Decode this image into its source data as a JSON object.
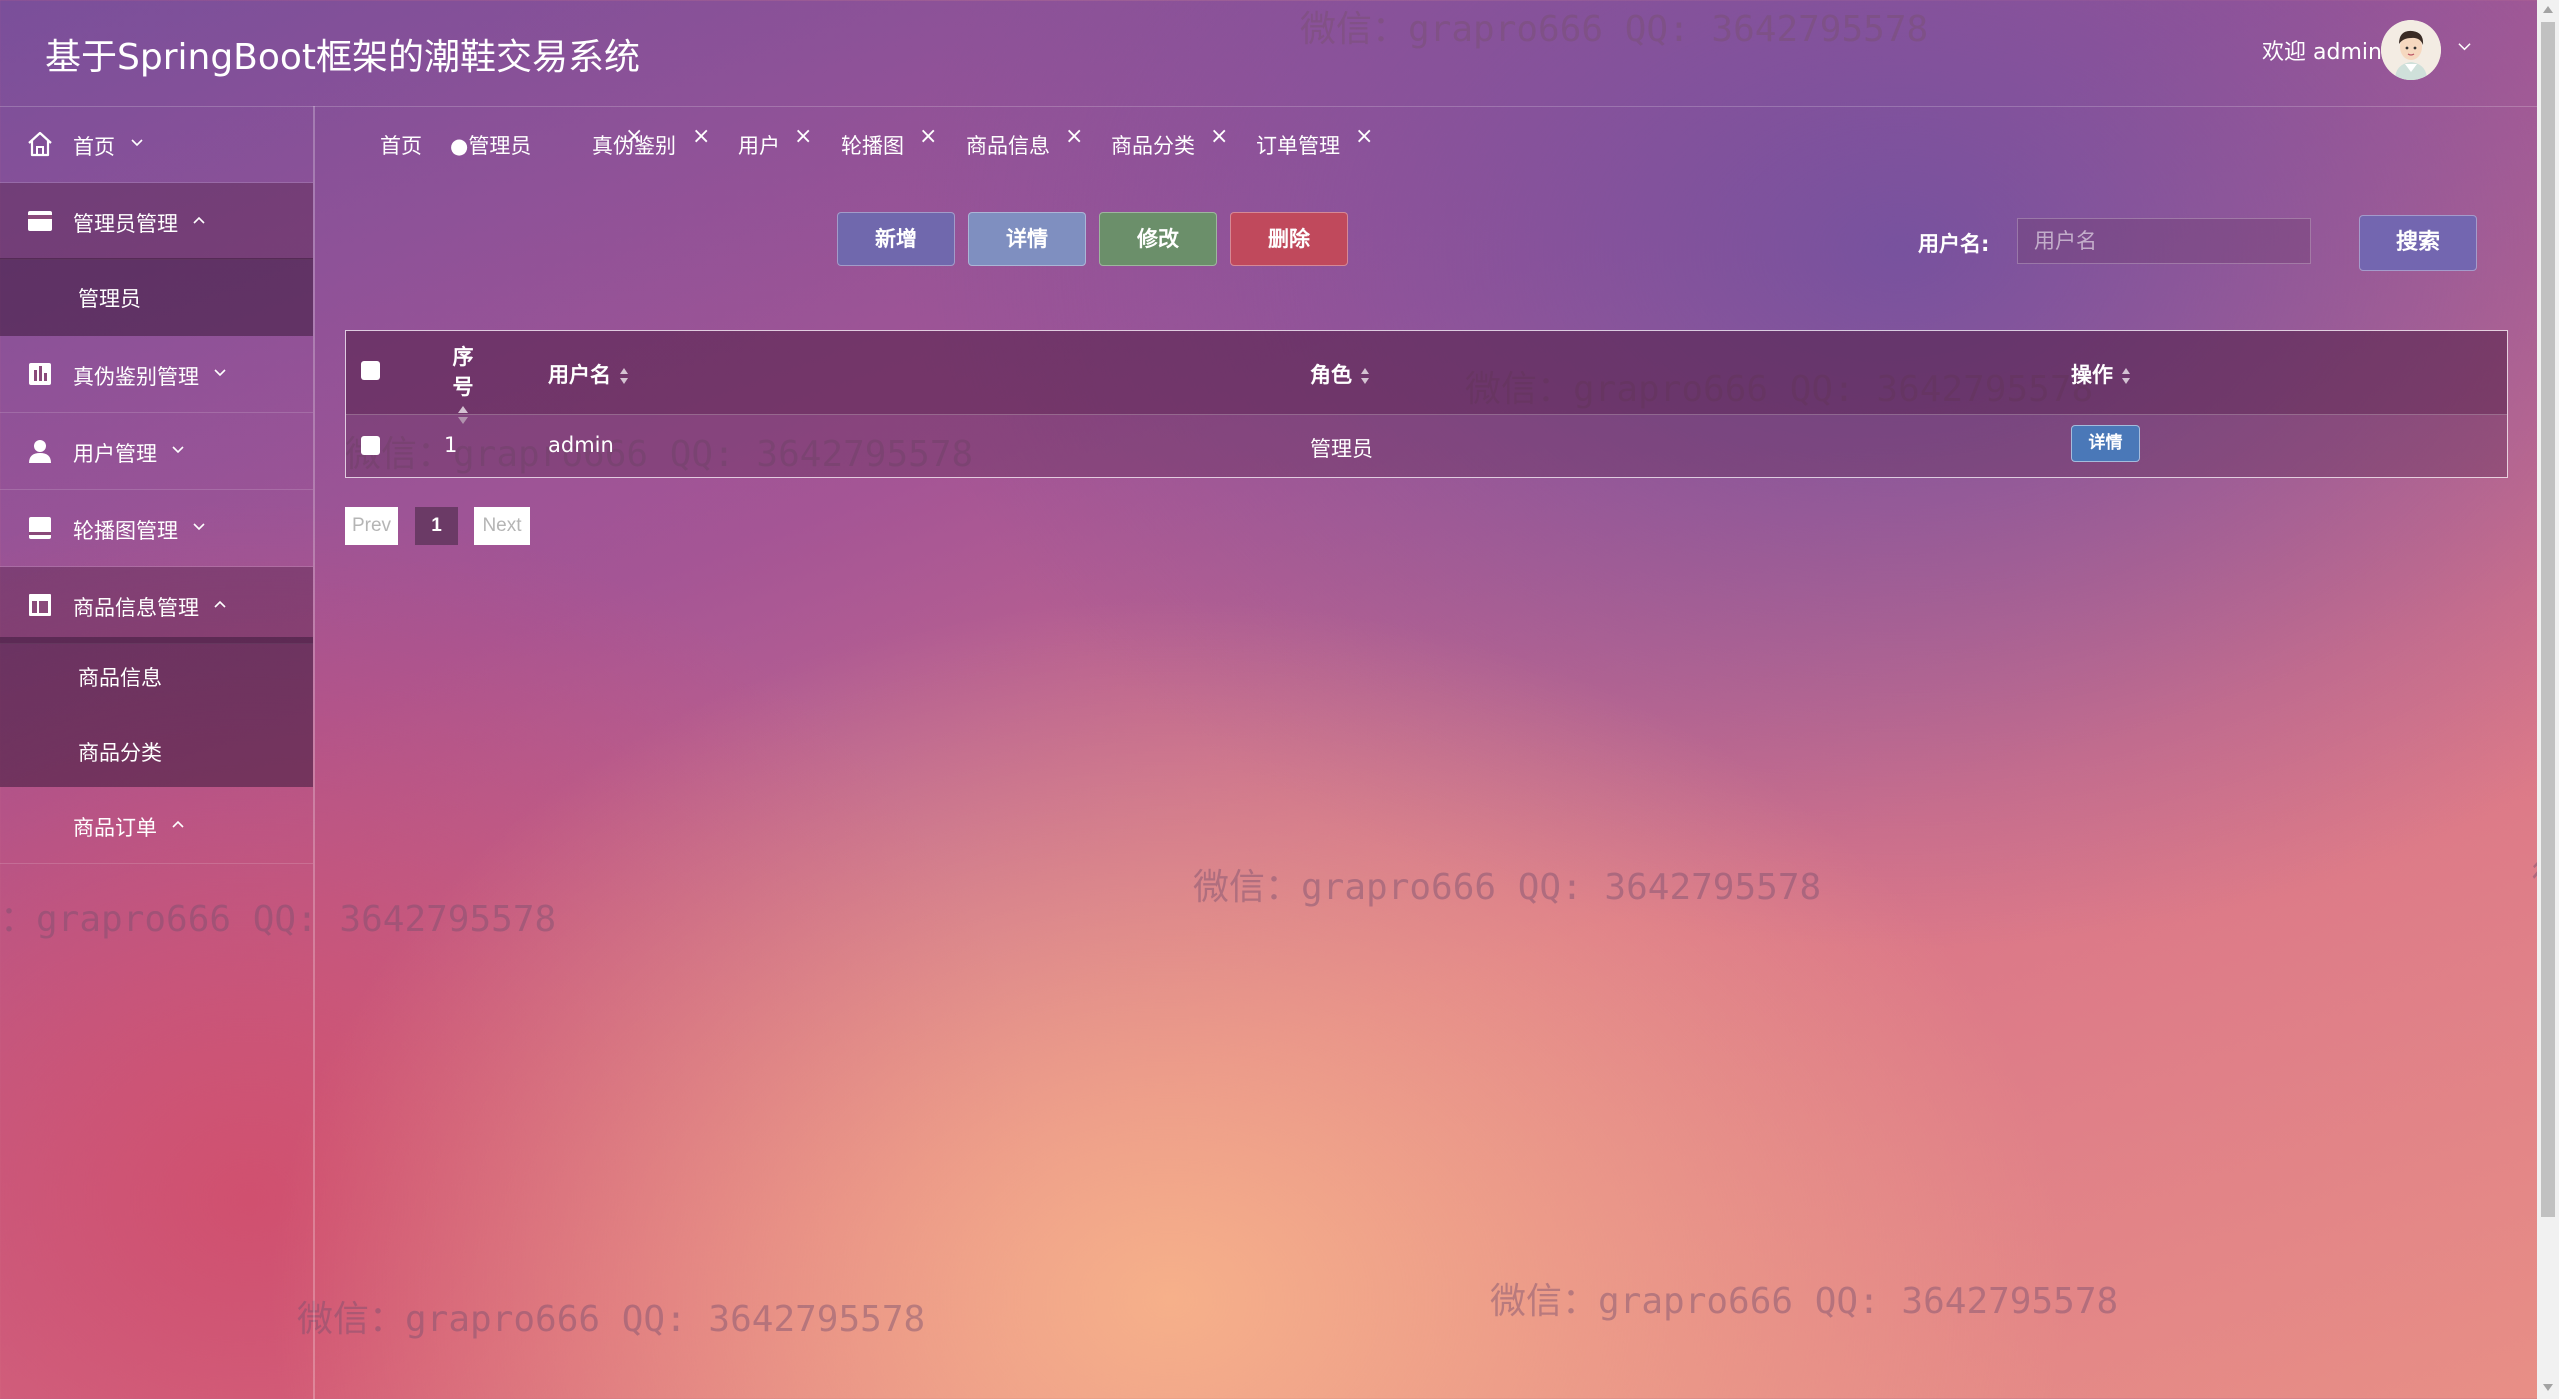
{
  "app_title": "基于SpringBoot框架的潮鞋交易系统",
  "header": {
    "welcome": "欢迎 admin"
  },
  "watermark": "微信：grapro666 QQ: 3642795578",
  "watermark_left_partial": "：grapro666 QQ: 3642795578",
  "watermark_right_partial": "微",
  "sidebar": {
    "items": [
      {
        "label": "首页",
        "icon": "home-icon",
        "chevron": "down"
      },
      {
        "label": "管理员管理",
        "icon": "card-icon",
        "chevron": "up"
      },
      {
        "label": "真伪鉴别管理",
        "icon": "chart-icon",
        "chevron": "down"
      },
      {
        "label": "用户管理",
        "icon": "user-icon",
        "chevron": "down"
      },
      {
        "label": "轮播图管理",
        "icon": "image-icon",
        "chevron": "down"
      },
      {
        "label": "商品信息管理",
        "icon": "layout-icon",
        "chevron": "up"
      },
      {
        "label": "商品订单",
        "icon": "",
        "chevron": "up"
      }
    ],
    "subitems": {
      "admin": [
        "管理员"
      ],
      "goods": [
        "商品信息",
        "商品分类"
      ]
    }
  },
  "tabs": [
    {
      "label": "首页",
      "closable": false,
      "active": false
    },
    {
      "label": "●管理员",
      "closable": true,
      "active": true
    },
    {
      "label": "真伪鉴别",
      "closable": true,
      "active": false
    },
    {
      "label": "用户",
      "closable": true,
      "active": false
    },
    {
      "label": "轮播图",
      "closable": true,
      "active": false
    },
    {
      "label": "商品信息",
      "closable": true,
      "active": false
    },
    {
      "label": "商品分类",
      "closable": true,
      "active": false
    },
    {
      "label": "订单管理",
      "closable": true,
      "active": false
    }
  ],
  "tab_close": "×",
  "toolbar": {
    "add": "新增",
    "detail": "详情",
    "edit": "修改",
    "delete": "删除",
    "colors": {
      "add": "#7068ad",
      "detail": "#7f8fc0",
      "edit": "#6b8f6a",
      "delete": "#c0495c"
    }
  },
  "search": {
    "label": "用户名:",
    "placeholder": "用户名",
    "button": "搜索"
  },
  "table": {
    "headers": {
      "index": "序号",
      "username": "用户名",
      "role": "角色",
      "actions": "操作"
    },
    "rows": [
      {
        "index": "1",
        "username": "admin",
        "role": "管理员",
        "action": "详情"
      }
    ]
  },
  "pagination": {
    "prev": "Prev",
    "current": "1",
    "next": "Next"
  }
}
